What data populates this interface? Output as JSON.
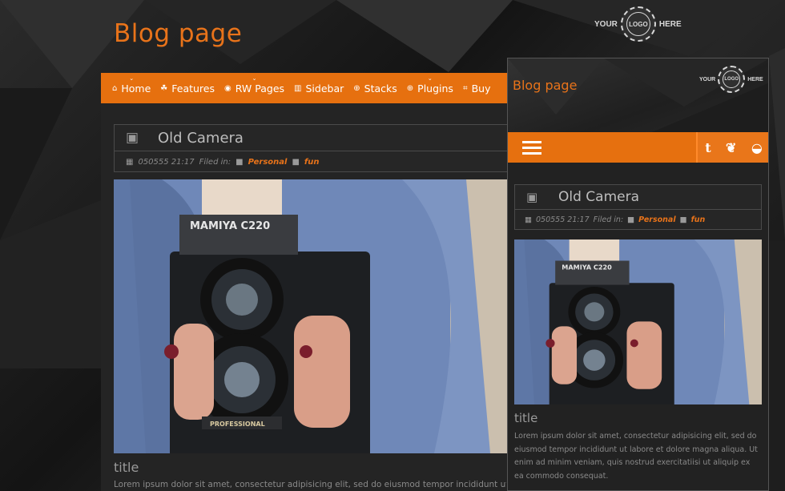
{
  "site": {
    "title": "Blog page",
    "logo": {
      "left": "YOUR",
      "center": "LOGO",
      "right": "HERE"
    }
  },
  "nav": {
    "items": [
      {
        "label": "Home",
        "icon": "home-icon",
        "glyph": "⌂"
      },
      {
        "label": "Features",
        "icon": "trophy-icon",
        "glyph": "☘"
      },
      {
        "label": "RW Pages",
        "icon": "eye-icon",
        "glyph": "◉"
      },
      {
        "label": "Sidebar",
        "icon": "columns-icon",
        "glyph": "▥"
      },
      {
        "label": "Stacks",
        "icon": "plus-circle-icon",
        "glyph": "⊕"
      },
      {
        "label": "Plugins",
        "icon": "plus-circle-icon",
        "glyph": "⊕"
      },
      {
        "label": "Buy",
        "icon": "cart-icon",
        "glyph": "⌗"
      }
    ]
  },
  "post": {
    "title": "Old Camera",
    "date": "050555 21:17",
    "filed_in": "Filed in:",
    "tags": [
      "Personal",
      "fun"
    ],
    "camera_brand": "MAMIYA C220",
    "camera_footer": "PROFESSIONAL",
    "subtitle": "title",
    "lorem_desktop": "Lorem ipsum dolor sit amet, consectetur adipisicing elit, sed do eiusmod tempor incididunt ut labor",
    "lorem_mobile": "Lorem ipsum dolor sit amet, consectetur adipisicing elit, sed do eiusmod tempor incididunt ut labore et dolore magna aliqua. Ut enim ad minim veniam, quis nostrud exercitatiisi ut aliquip ex ea commodo consequat."
  },
  "mobile": {
    "social": [
      {
        "icon": "tumblr-icon",
        "glyph": "t"
      },
      {
        "icon": "evernote-icon",
        "glyph": "❦"
      },
      {
        "icon": "rss-icon",
        "glyph": "◒"
      }
    ]
  },
  "colors": {
    "accent": "#e6700f",
    "tag": "#e8731a",
    "background": "#1c1c1c"
  }
}
